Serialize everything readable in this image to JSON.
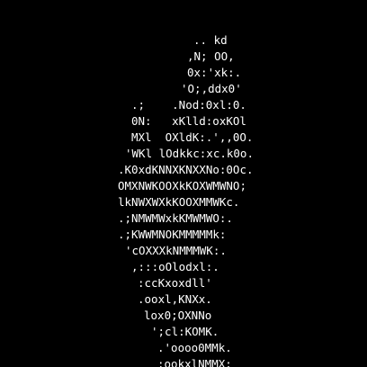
{
  "ascii_art": {
    "lines": [
      ".. kd",
      ",N; OO,",
      "0x:'xk:.",
      "'O;,ddx0'",
      ".;    .Nod:0xl:0.",
      "0N:   xKlld:oxKOl",
      "MXl  OXldK:.',,0O.",
      "'WKl lOdkkc:xc.k0o.",
      ".K0xdKNNXKNXXNo:0Oc.",
      "OMXNWKOOXkKOXWMWNO;",
      "lkNWXWXkKOOXMMWKc.",
      ".;NMWMWxkKMWMWO:.",
      ".;KWWMNOKMMMMMk:",
      "'cOXXXkNMMMWK:.",
      ",:::oOlodxl:.",
      ":ccKxoxdll'",
      ".ooxl,KNXx.",
      "lox0;OXNNo",
      "';cl:KOMK.",
      ".'oooo0MMk.",
      ":ookxlNMMX:"
    ]
  },
  "colors": {
    "background": "#000000",
    "text": "#ffffff"
  }
}
